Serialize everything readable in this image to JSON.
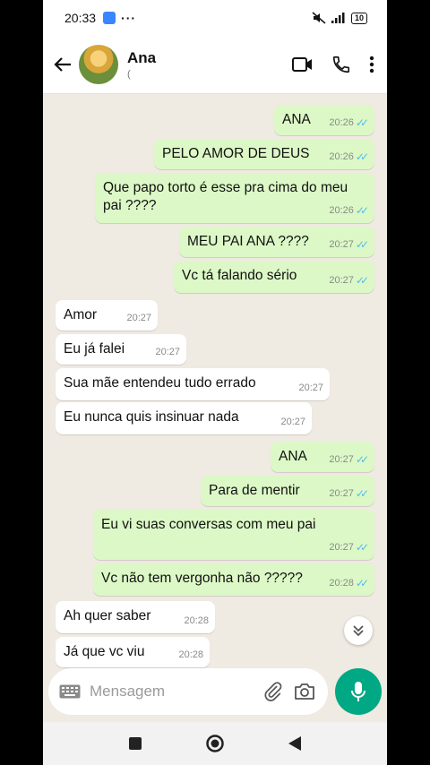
{
  "status_bar": {
    "time": "20:33",
    "dots": "···",
    "battery": "10"
  },
  "header": {
    "contact_name": "Ana",
    "contact_status": "("
  },
  "messages": [
    {
      "dir": "out",
      "text": "ANA",
      "time": "20:26"
    },
    {
      "dir": "out",
      "text": "PELO AMOR DE DEUS",
      "time": "20:26"
    },
    {
      "dir": "out",
      "text": "Que papo torto é esse pra cima do meu pai ????",
      "time": "20:26"
    },
    {
      "dir": "out",
      "text": "MEU PAI ANA ????",
      "time": "20:27"
    },
    {
      "dir": "out",
      "text": "Vc tá falando sério",
      "time": "20:27"
    },
    {
      "dir": "in",
      "text": "Amor",
      "time": "20:27"
    },
    {
      "dir": "in",
      "text": "Eu já falei",
      "time": "20:27"
    },
    {
      "dir": "in",
      "text": "Sua mãe entendeu tudo errado",
      "time": "20:27"
    },
    {
      "dir": "in",
      "text": "Eu nunca quis insinuar nada",
      "time": "20:27"
    },
    {
      "dir": "out",
      "text": "ANA",
      "time": "20:27"
    },
    {
      "dir": "out",
      "text": "Para de mentir",
      "time": "20:27"
    },
    {
      "dir": "out",
      "text": "Eu vi suas conversas com meu pai",
      "time": "20:27"
    },
    {
      "dir": "out",
      "text": "Vc não tem vergonha não ?????",
      "time": "20:28"
    },
    {
      "dir": "in",
      "text": "Ah quer saber",
      "time": "20:28"
    },
    {
      "dir": "in",
      "text": "Já que vc viu",
      "time": "20:28"
    }
  ],
  "composer": {
    "placeholder": "Mensagem"
  },
  "colors": {
    "outgoing_bubble": "#dcf8c6",
    "incoming_bubble": "#ffffff",
    "mic_button": "#00a884",
    "read_ticks": "#53bdeb",
    "chat_bg": "#efeae2"
  }
}
